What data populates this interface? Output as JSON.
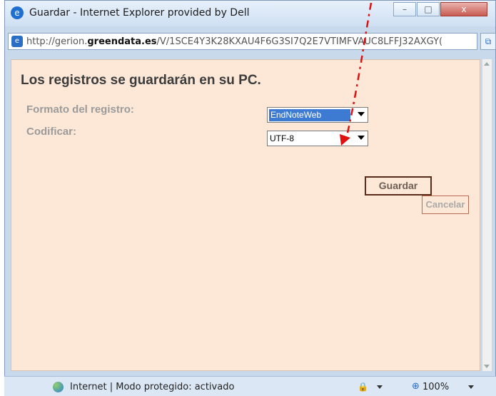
{
  "window": {
    "title": "Guardar - Internet Explorer provided by Dell",
    "minimize_glyph": "–",
    "maximize_glyph": "□",
    "close_glyph": "x"
  },
  "address": {
    "url_prefix": "http://gerion.",
    "url_domain": "greendata.es",
    "url_path": "/V/1SCE4Y3K28KXAU4F6G3SI7Q2E7VTIMFVAUC8LFFJ32AXGY("
  },
  "page": {
    "heading": "Los registros se guardarán en su PC.",
    "format_label": "Formato del registro:",
    "format_value": "EndNoteWeb",
    "encoding_label": "Codificar:",
    "encoding_value": "UTF-8",
    "save_button": "Guardar",
    "cancel_button": "Cancelar"
  },
  "statusbar": {
    "zone_text": "Internet | Modo protegido: activado",
    "zoom": "100%"
  },
  "colors": {
    "content_bg": "#fde8d7",
    "annotation_arrow": "#e01010",
    "selected_highlight": "#3d7bd3"
  },
  "icons": {
    "browser": "ie-icon",
    "page": "page-icon",
    "compat": "compatibility-view-icon",
    "globe": "globe-icon",
    "security": "security-zone-icon",
    "zoom": "zoom-icon"
  }
}
